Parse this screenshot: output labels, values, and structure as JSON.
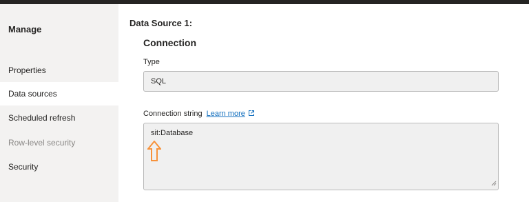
{
  "sidebar": {
    "title": "Manage",
    "items": [
      {
        "label": "Properties"
      },
      {
        "label": "Data sources"
      },
      {
        "label": "Scheduled refresh"
      },
      {
        "label": "Row-level security"
      },
      {
        "label": "Security"
      }
    ]
  },
  "main": {
    "data_source_title": "Data Source 1:",
    "section_title": "Connection",
    "type_label": "Type",
    "type_value": "SQL",
    "connection_string_label": "Connection string",
    "learn_more_label": "Learn more",
    "connection_string_value": "sit:Database"
  },
  "colors": {
    "link": "#106ebe",
    "arrow": "#f7923b",
    "sidebar_bg": "#f3f2f1"
  },
  "icons": [
    "external-link-icon",
    "resize-grip-icon",
    "up-arrow-icon"
  ]
}
